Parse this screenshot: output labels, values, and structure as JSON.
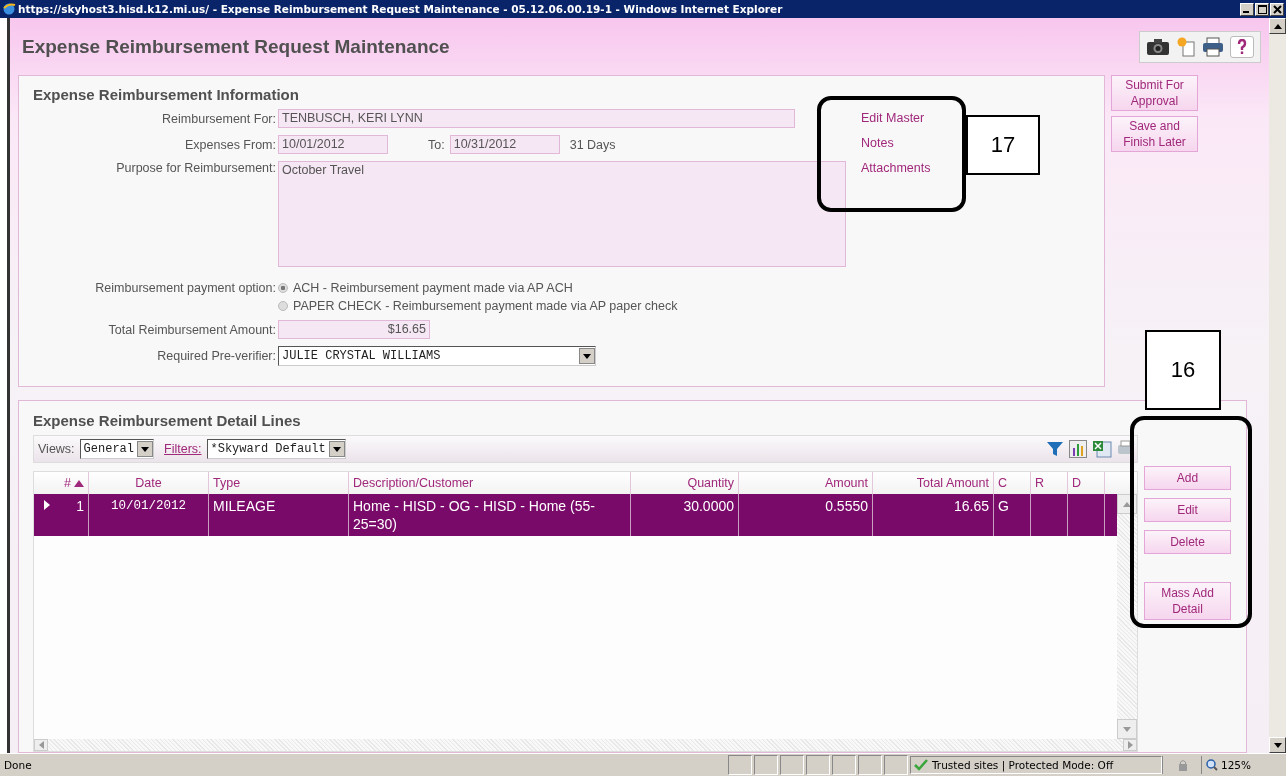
{
  "window": {
    "title": "https://skyhost3.hisd.k12.mi.us/ - Expense Reimbursement Request Maintenance - 05.12.06.00.19-1 - Windows Internet Explorer"
  },
  "page": {
    "title": "Expense Reimbursement Request Maintenance"
  },
  "side_buttons": [
    "Submit For Approval",
    "Save and Finish Later"
  ],
  "info": {
    "heading": "Expense Reimbursement Information",
    "reimbursement_for": {
      "label": "Reimbursement For:",
      "value": "TENBUSCH, KERI LYNN"
    },
    "expenses_from": {
      "label": "Expenses From:",
      "value": "10/01/2012"
    },
    "expenses_to": {
      "label": "To:",
      "value": "10/31/2012"
    },
    "days": "31 Days",
    "purpose": {
      "label": "Purpose for Reimbursement:",
      "value": "October Travel"
    },
    "payment": {
      "label": "Reimbursement payment option:",
      "options": [
        {
          "label": "ACH - Reimbursement payment made via AP ACH",
          "selected": true
        },
        {
          "label": "PAPER CHECK - Reimbursement payment made via AP paper check",
          "selected": false
        }
      ]
    },
    "total": {
      "label": "Total Reimbursement Amount:",
      "value": "$16.65"
    },
    "preverifier": {
      "label": "Required Pre-verifier:",
      "value": "JULIE CRYSTAL WILLIAMS"
    },
    "links": [
      "Edit Master",
      "Notes",
      "Attachments"
    ]
  },
  "detail": {
    "heading": "Expense Reimbursement Detail Lines",
    "views": {
      "label": "Views:",
      "value": "General"
    },
    "filters": {
      "label": "Filters:",
      "value": "*Skyward Default"
    },
    "columns": [
      {
        "label": "#",
        "sorted": true
      },
      {
        "label": "Date",
        "sorted": false
      },
      {
        "label": "Type",
        "sorted": false
      },
      {
        "label": "Description/Customer",
        "sorted": false
      },
      {
        "label": "Quantity",
        "sorted": false
      },
      {
        "label": "Amount",
        "sorted": false
      },
      {
        "label": "Total Amount",
        "sorted": false
      },
      {
        "label": "C",
        "sorted": false
      },
      {
        "label": "R",
        "sorted": false
      },
      {
        "label": "D",
        "sorted": false
      }
    ],
    "rows": [
      {
        "selected": true,
        "cells": [
          "1",
          "10/01/2012",
          "MILEAGE",
          "Home - HISD - OG - HISD - Home (55-25=30)",
          "30.0000",
          "0.5550",
          "16.65",
          "G",
          "",
          ""
        ]
      }
    ],
    "buttons": [
      "Add",
      "Edit",
      "Delete",
      "Mass Add Detail"
    ]
  },
  "annotations": [
    "17",
    "16"
  ],
  "status_bar": {
    "text": "Done",
    "zone": "Trusted sites | Protected Mode: Off",
    "zoom": "125%"
  }
}
